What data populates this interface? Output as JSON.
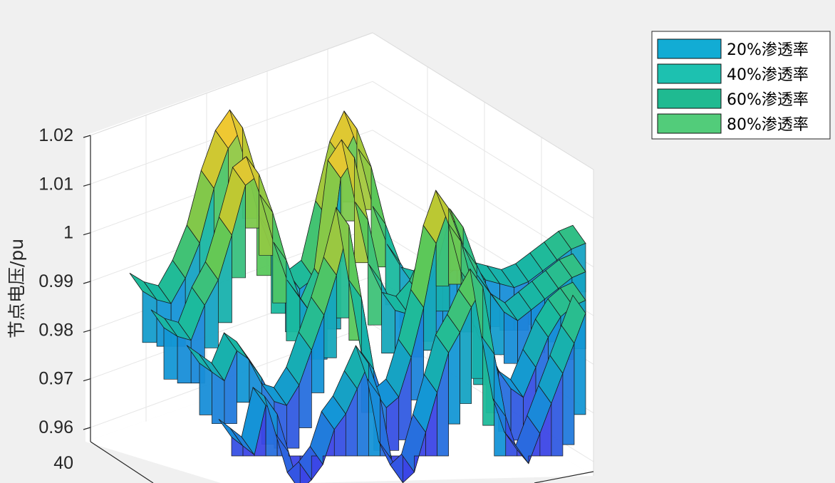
{
  "chart_data": {
    "type": "surface",
    "title": "",
    "ylabel": "节点电压/pu",
    "zlim": [
      0.955,
      1.02
    ],
    "z_ticks": [
      0.96,
      0.97,
      0.98,
      0.99,
      1,
      1.01,
      1.02
    ],
    "z_tick_labels": [
      "0.96",
      "0.97",
      "0.98",
      "0.99",
      "1",
      "1.01",
      "1.02"
    ],
    "extra_axis_tick": "40",
    "grid": true,
    "legend_position": "top-right",
    "series": [
      {
        "name": "20%渗透率",
        "color": "#12acd4",
        "profile": [
          0.972,
          0.97,
          0.968,
          0.978,
          0.976,
          0.968,
          0.96,
          0.962,
          0.965,
          0.972,
          0.975,
          0.98,
          0.985,
          0.978,
          0.965,
          0.96,
          0.962,
          0.97,
          0.978,
          0.986,
          0.99,
          0.995,
          0.999,
          0.985,
          0.972,
          0.965,
          0.962,
          0.968,
          0.974,
          0.98,
          0.986,
          0.992
        ]
      },
      {
        "name": "40%渗透率",
        "color": "#1dc1b0",
        "profile": [
          0.984,
          0.982,
          0.98,
          0.986,
          0.984,
          0.98,
          0.975,
          0.974,
          0.978,
          0.985,
          0.992,
          1.0,
          1.01,
          0.995,
          0.98,
          0.972,
          0.974,
          0.982,
          0.992,
          1.005,
          1.012,
          1.005,
          0.995,
          0.984,
          0.978,
          0.974,
          0.972,
          0.978,
          0.984,
          0.988,
          0.99,
          0.991
        ]
      },
      {
        "name": "60%渗透率",
        "color": "#1fba91",
        "profile": [
          0.986,
          0.984,
          0.983,
          0.99,
          0.995,
          1.004,
          1.014,
          1.016,
          1.008,
          0.998,
          0.99,
          0.986,
          0.992,
          1.014,
          1.018,
          1.005,
          0.992,
          0.986,
          0.985,
          0.988,
          0.994,
          1.004,
          1.002,
          0.994,
          0.988,
          0.984,
          0.982,
          0.984,
          0.986,
          0.988,
          0.99,
          0.991
        ]
      },
      {
        "name": "80%渗透率",
        "color": "#52cc7a",
        "profile": [
          0.988,
          0.986,
          0.985,
          0.99,
          0.997,
          1.008,
          1.016,
          1.02,
          1.01,
          0.998,
          0.99,
          0.986,
          0.988,
          1.0,
          1.012,
          1.018,
          1.01,
          0.998,
          0.99,
          0.985,
          0.984,
          0.986,
          0.988,
          0.987,
          0.985,
          0.984,
          0.983,
          0.984,
          0.986,
          0.988,
          0.99,
          0.991
        ]
      }
    ]
  },
  "legend": {
    "items": [
      {
        "label": "20%渗透率",
        "color": "#12acd4"
      },
      {
        "label": "40%渗透率",
        "color": "#1dc1b0"
      },
      {
        "label": "60%渗透率",
        "color": "#1fba91"
      },
      {
        "label": "80%渗透率",
        "color": "#52cc7a"
      }
    ]
  }
}
